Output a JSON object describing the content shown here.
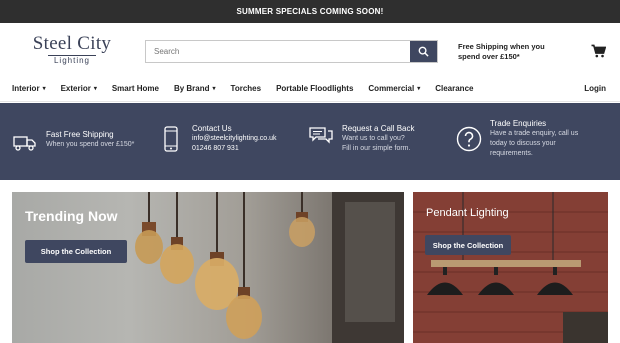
{
  "announcement": {
    "text": "SUMMER SPECIALS COMING SOON!"
  },
  "logo": {
    "main": "Steel City",
    "sub": "Lighting"
  },
  "search": {
    "placeholder": "Search"
  },
  "shipping_note": {
    "line1": "Free Shipping when you",
    "line2": "spend over £150*"
  },
  "nav": {
    "items": [
      {
        "label": "Interior",
        "dropdown": true
      },
      {
        "label": "Exterior",
        "dropdown": true
      },
      {
        "label": "Smart Home",
        "dropdown": false
      },
      {
        "label": "By Brand",
        "dropdown": true
      },
      {
        "label": "Torches",
        "dropdown": false
      },
      {
        "label": "Portable Floodlights",
        "dropdown": false
      },
      {
        "label": "Commercial",
        "dropdown": true
      },
      {
        "label": "Clearance",
        "dropdown": false
      }
    ],
    "login": "Login"
  },
  "features": [
    {
      "icon": "truck-icon",
      "title": "Fast Free Shipping",
      "lines": [
        "When you spend over £150*"
      ]
    },
    {
      "icon": "phone-icon",
      "title": "Contact Us",
      "lines": [
        "info@steelcitylighting.co.uk",
        "01246 807 931"
      ]
    },
    {
      "icon": "chat-icon",
      "title": "Request a Call Back",
      "lines": [
        "Want us to call you?",
        "Fill in our simple form."
      ]
    },
    {
      "icon": "question-icon",
      "title": "Trade Enquiries",
      "lines": [
        "Have a trade enquiry, call us",
        "today to discuss your",
        "requirements."
      ]
    }
  ],
  "banners": {
    "trending": {
      "title": "Trending Now",
      "button": "Shop the Collection"
    },
    "pendant": {
      "title": "Pendant Lighting",
      "button": "Shop the Collection"
    }
  },
  "colors": {
    "brand": "#3f4760",
    "topbar": "#2f2f2f"
  }
}
